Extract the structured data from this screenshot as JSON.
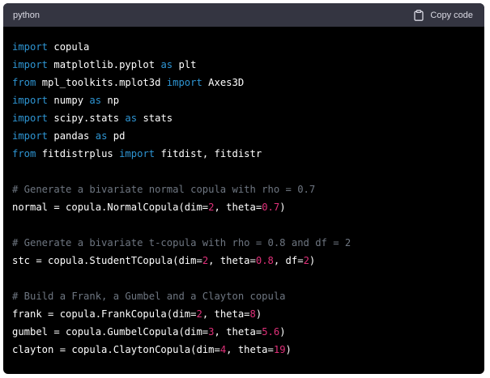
{
  "header": {
    "language": "python",
    "copy_label": "Copy code",
    "copy_icon": "clipboard-icon"
  },
  "colors": {
    "keyword": "#2e95d3",
    "number": "#df3079",
    "comment": "#6e7681",
    "text": "#ffffff",
    "header_bg": "#343541",
    "code_bg": "#000000"
  },
  "code_lines": [
    [
      {
        "t": "import",
        "c": "kw"
      },
      {
        "t": " copula",
        "c": ""
      }
    ],
    [
      {
        "t": "import",
        "c": "kw"
      },
      {
        "t": " matplotlib.pyplot ",
        "c": ""
      },
      {
        "t": "as",
        "c": "kw"
      },
      {
        "t": " plt",
        "c": ""
      }
    ],
    [
      {
        "t": "from",
        "c": "kw"
      },
      {
        "t": " mpl_toolkits.mplot3d ",
        "c": ""
      },
      {
        "t": "import",
        "c": "kw"
      },
      {
        "t": " Axes3D",
        "c": ""
      }
    ],
    [
      {
        "t": "import",
        "c": "kw"
      },
      {
        "t": " numpy ",
        "c": ""
      },
      {
        "t": "as",
        "c": "kw"
      },
      {
        "t": " np",
        "c": ""
      }
    ],
    [
      {
        "t": "import",
        "c": "kw"
      },
      {
        "t": " scipy.stats ",
        "c": ""
      },
      {
        "t": "as",
        "c": "kw"
      },
      {
        "t": " stats",
        "c": ""
      }
    ],
    [
      {
        "t": "import",
        "c": "kw"
      },
      {
        "t": " pandas ",
        "c": ""
      },
      {
        "t": "as",
        "c": "kw"
      },
      {
        "t": " pd",
        "c": ""
      }
    ],
    [
      {
        "t": "from",
        "c": "kw"
      },
      {
        "t": " fitdistrplus ",
        "c": ""
      },
      {
        "t": "import",
        "c": "kw"
      },
      {
        "t": " fitdist, fitdistr",
        "c": ""
      }
    ],
    [],
    [
      {
        "t": "# Generate a bivariate normal copula with rho = 0.7",
        "c": "com"
      }
    ],
    [
      {
        "t": "normal = copula.NormalCopula(dim=",
        "c": ""
      },
      {
        "t": "2",
        "c": "num"
      },
      {
        "t": ", theta=",
        "c": ""
      },
      {
        "t": "0.7",
        "c": "num"
      },
      {
        "t": ")",
        "c": ""
      }
    ],
    [],
    [
      {
        "t": "# Generate a bivariate t-copula with rho = 0.8 and df = 2",
        "c": "com"
      }
    ],
    [
      {
        "t": "stc = copula.StudentTCopula(dim=",
        "c": ""
      },
      {
        "t": "2",
        "c": "num"
      },
      {
        "t": ", theta=",
        "c": ""
      },
      {
        "t": "0.8",
        "c": "num"
      },
      {
        "t": ", df=",
        "c": ""
      },
      {
        "t": "2",
        "c": "num"
      },
      {
        "t": ")",
        "c": ""
      }
    ],
    [],
    [
      {
        "t": "# Build a Frank, a Gumbel and a Clayton copula",
        "c": "com"
      }
    ],
    [
      {
        "t": "frank = copula.FrankCopula(dim=",
        "c": ""
      },
      {
        "t": "2",
        "c": "num"
      },
      {
        "t": ", theta=",
        "c": ""
      },
      {
        "t": "8",
        "c": "num"
      },
      {
        "t": ")",
        "c": ""
      }
    ],
    [
      {
        "t": "gumbel = copula.GumbelCopula(dim=",
        "c": ""
      },
      {
        "t": "3",
        "c": "num"
      },
      {
        "t": ", theta=",
        "c": ""
      },
      {
        "t": "5.6",
        "c": "num"
      },
      {
        "t": ")",
        "c": ""
      }
    ],
    [
      {
        "t": "clayton = copula.ClaytonCopula(dim=",
        "c": ""
      },
      {
        "t": "4",
        "c": "num"
      },
      {
        "t": ", theta=",
        "c": ""
      },
      {
        "t": "19",
        "c": "num"
      },
      {
        "t": ")",
        "c": ""
      }
    ]
  ]
}
